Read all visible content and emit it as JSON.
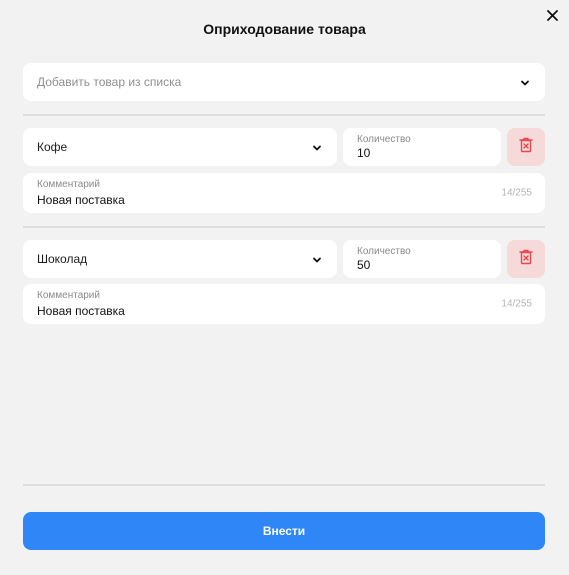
{
  "dialog": {
    "title": "Оприходование товара",
    "close_icon": "close-icon"
  },
  "add_product": {
    "placeholder": "Добавить товар из списка",
    "icon": "chevron-down-icon"
  },
  "items": [
    {
      "product": "Кофе",
      "quantity_label": "Количество",
      "quantity": "10",
      "comment_label": "Комментарий",
      "comment": "Новая поставка",
      "counter": "14/255",
      "delete_icon": "trash-icon"
    },
    {
      "product": "Шоколад",
      "quantity_label": "Количество",
      "quantity": "50",
      "comment_label": "Комментарий",
      "comment": "Новая поставка",
      "counter": "14/255",
      "delete_icon": "trash-icon"
    }
  ],
  "submit_label": "Внести",
  "colors": {
    "background": "#f2f2f2",
    "card": "#ffffff",
    "primary": "#2e86f7",
    "danger": "#e5484d",
    "danger_bg": "#f6d9d9"
  }
}
